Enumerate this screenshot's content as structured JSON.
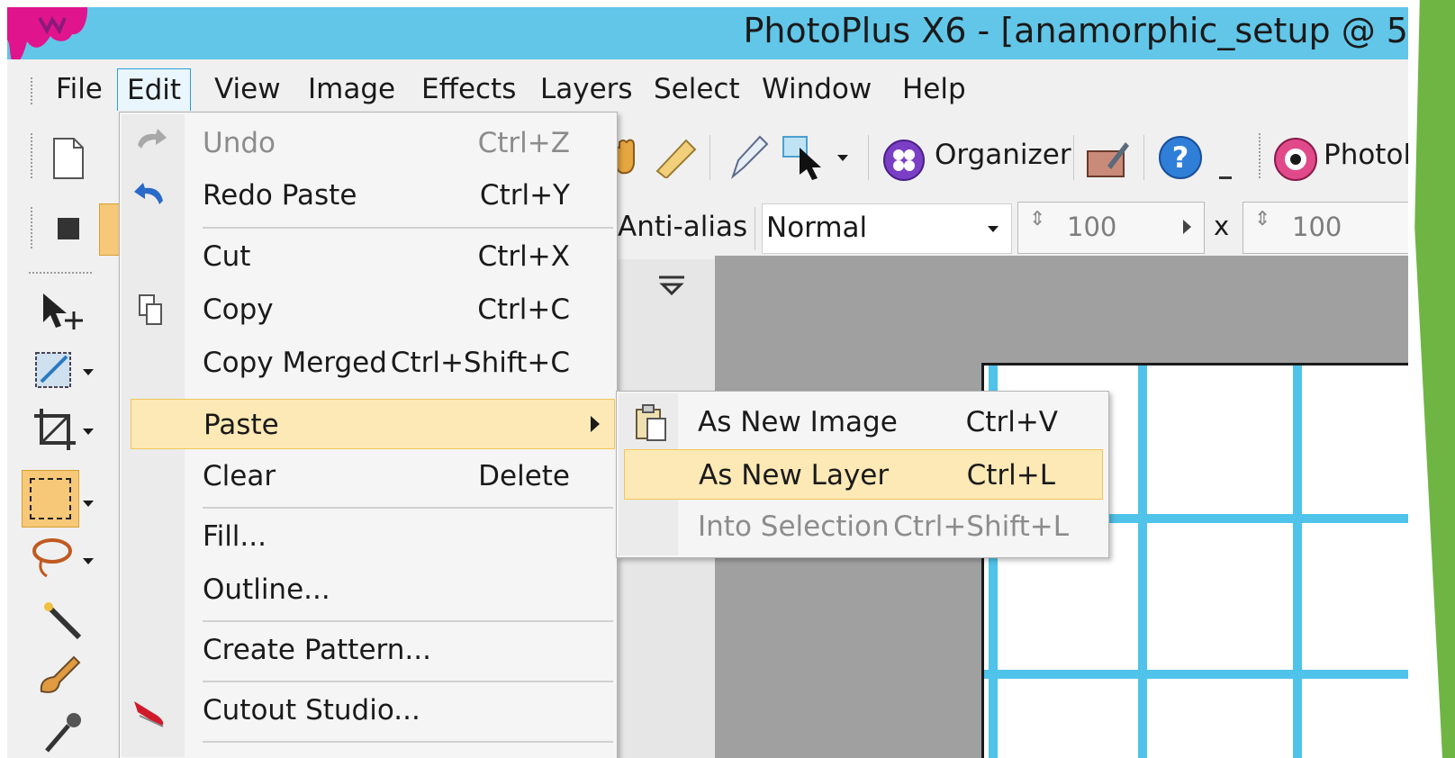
{
  "window": {
    "title": "PhotoPlus X6 - [anamorphic_setup @ 5"
  },
  "menubar": {
    "items": [
      "File",
      "Edit",
      "View",
      "Image",
      "Effects",
      "Layers",
      "Select",
      "Window",
      "Help"
    ],
    "active": "Edit"
  },
  "toolbar": {
    "organizer_label": "Organizer",
    "photo_label": "PhotoF",
    "help_icon": "question-icon"
  },
  "context_toolbar": {
    "antialias_label": "Anti-alias",
    "blend_mode_value": "Normal",
    "width_value": "100",
    "height_value": "100",
    "times_label": "x"
  },
  "edit_menu": {
    "items": [
      {
        "label": "Undo",
        "shortcut": "Ctrl+Z",
        "disabled": true,
        "icon": "undo-icon"
      },
      {
        "label": "Redo Paste",
        "shortcut": "Ctrl+Y",
        "disabled": false,
        "icon": "redo-icon"
      },
      {
        "label": "Cut",
        "shortcut": "Ctrl+X",
        "disabled": false
      },
      {
        "label": "Copy",
        "shortcut": "Ctrl+C",
        "disabled": false,
        "icon": "copy-icon"
      },
      {
        "label": "Copy Merged",
        "shortcut": "Ctrl+Shift+C",
        "disabled": false
      },
      {
        "label": "Paste",
        "shortcut": "",
        "disabled": false,
        "highlighted": true,
        "has_submenu": true
      },
      {
        "label": "Clear",
        "shortcut": "Delete",
        "disabled": false
      },
      {
        "label": "Fill...",
        "shortcut": "",
        "disabled": false
      },
      {
        "label": "Outline...",
        "shortcut": "",
        "disabled": false
      },
      {
        "label": "Create Pattern...",
        "shortcut": "",
        "disabled": false
      },
      {
        "label": "Cutout Studio...",
        "shortcut": "",
        "disabled": false,
        "icon": "cutout-studio-icon"
      }
    ]
  },
  "paste_submenu": {
    "items": [
      {
        "label": "As New Image",
        "shortcut": "Ctrl+V",
        "disabled": false,
        "icon": "clipboard-icon"
      },
      {
        "label": "As New Layer",
        "shortcut": "Ctrl+L",
        "disabled": false,
        "highlighted": true
      },
      {
        "label": "Into Selection",
        "shortcut": "Ctrl+Shift+L",
        "disabled": true
      }
    ]
  },
  "colors": {
    "titlebar": "#62c6e8",
    "highlight": "#fde9b5",
    "grid": "#4fc3ea",
    "slide_accent": "#6fb544",
    "logo": "#e0148c"
  }
}
